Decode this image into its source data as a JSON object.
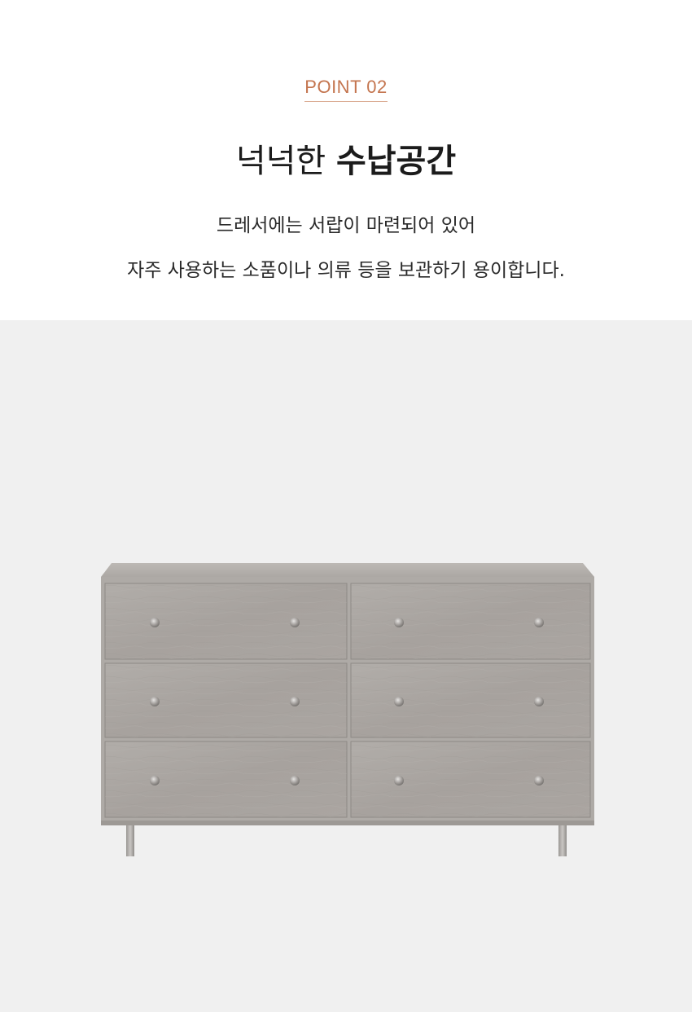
{
  "point": {
    "label": "POINT 02"
  },
  "headline": {
    "light": "넉넉한",
    "bold": "수납공간"
  },
  "description": {
    "line1": "드레서에는 서랍이 마련되어 있어",
    "line2": "자주 사용하는 소품이나 의류 등을 보관하기 용이합니다."
  },
  "colors": {
    "accent": "#c4754f",
    "showcase_bg": "#f0f0f0",
    "wood": "#a9a4a0"
  }
}
